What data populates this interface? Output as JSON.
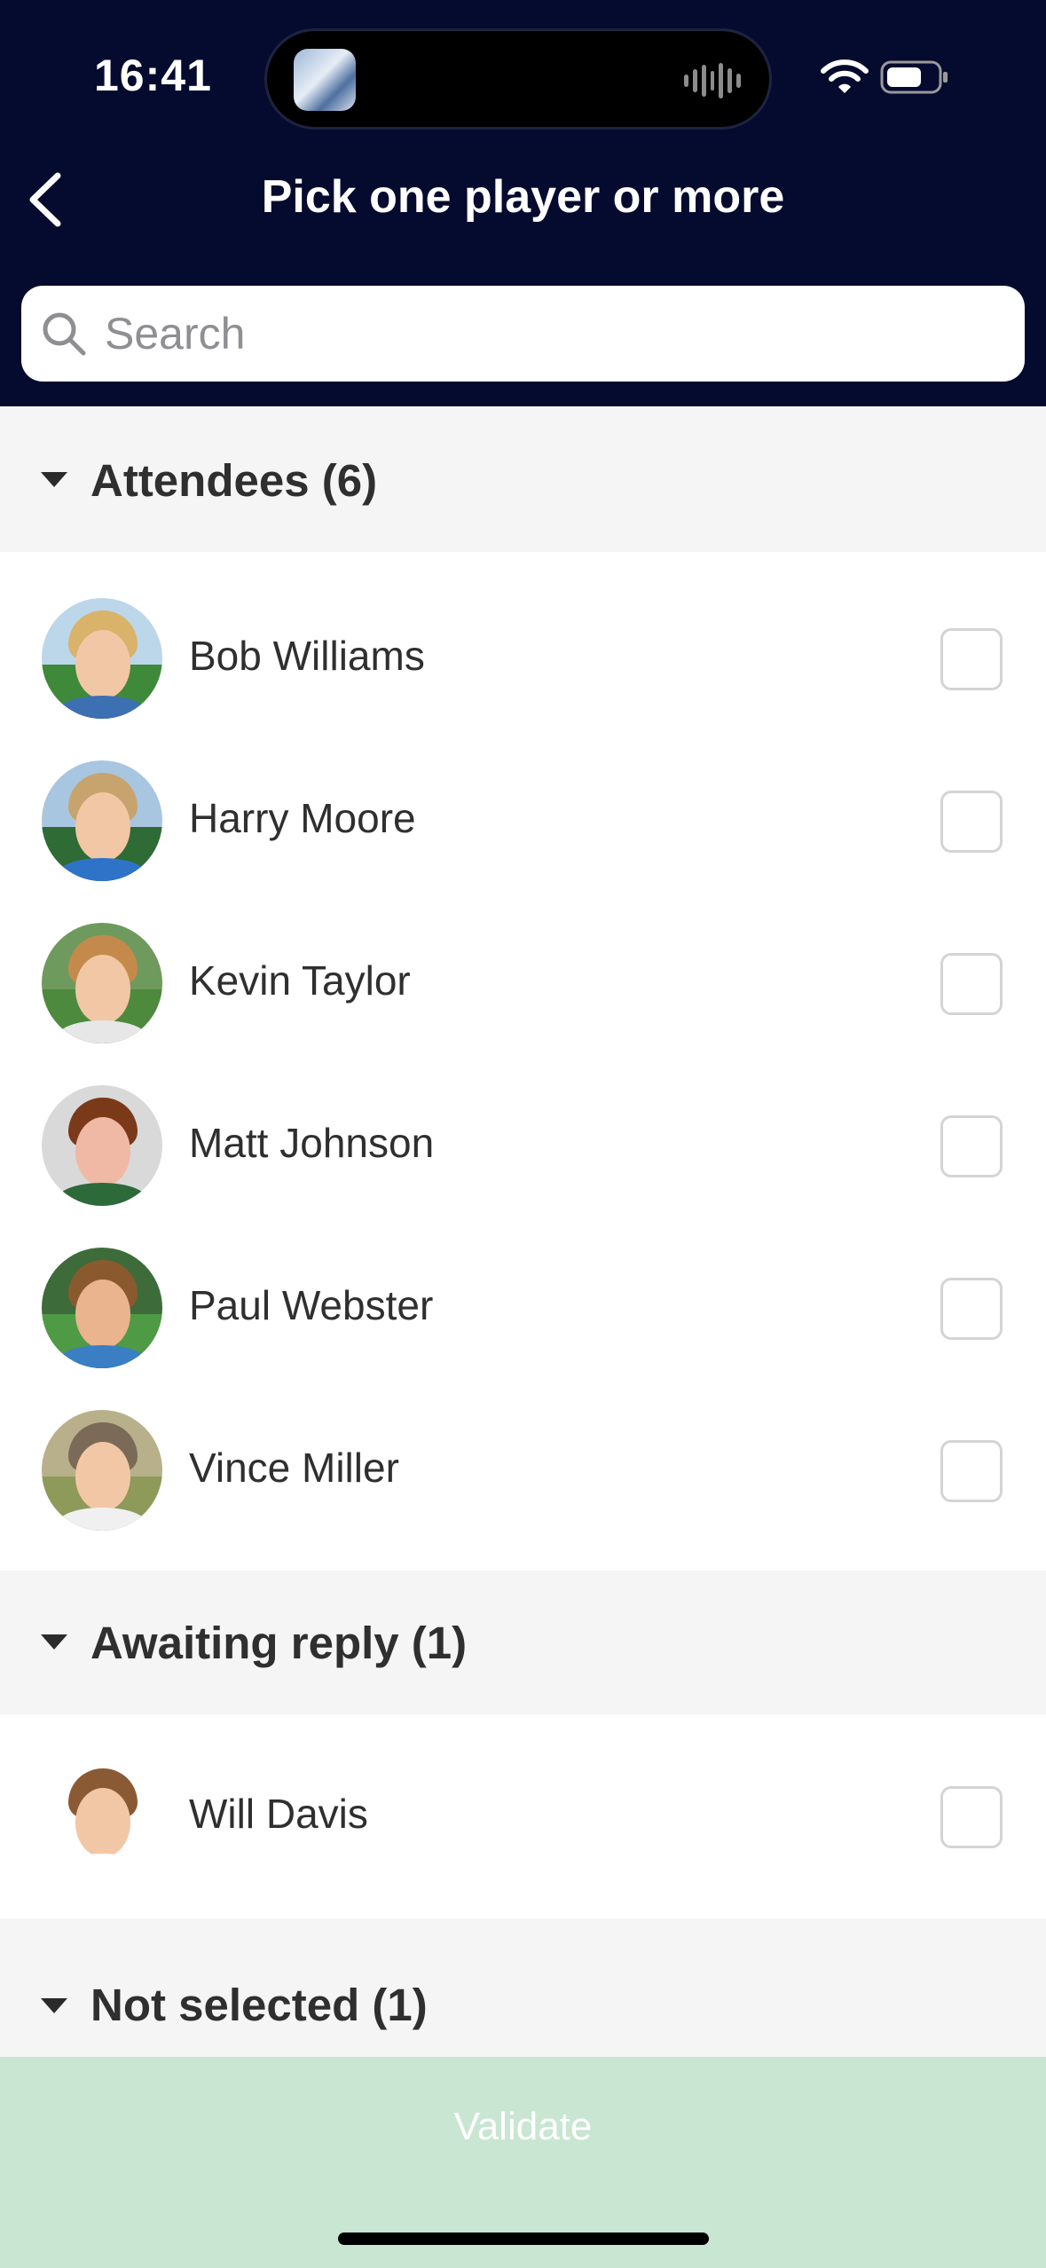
{
  "status_bar": {
    "time": "16:41"
  },
  "header": {
    "title": "Pick one player or more"
  },
  "search": {
    "placeholder": "Search",
    "value": ""
  },
  "sections": {
    "attendees": {
      "label": "Attendees (6)",
      "players": [
        {
          "name": "Bob Williams",
          "checked": false
        },
        {
          "name": "Harry Moore",
          "checked": false
        },
        {
          "name": "Kevin Taylor",
          "checked": false
        },
        {
          "name": "Matt Johnson",
          "checked": false
        },
        {
          "name": "Paul Webster",
          "checked": false
        },
        {
          "name": "Vince Miller",
          "checked": false
        }
      ]
    },
    "awaiting": {
      "label": "Awaiting reply (1)",
      "players": [
        {
          "name": "Will Davis",
          "checked": false
        }
      ]
    },
    "not_selected": {
      "label": "Not selected (1)"
    }
  },
  "footer": {
    "validate_label": "Validate"
  },
  "colors": {
    "header_bg": "#050b2e",
    "section_bg": "#f5f5f5",
    "validate_bg": "#c8e6d1"
  }
}
